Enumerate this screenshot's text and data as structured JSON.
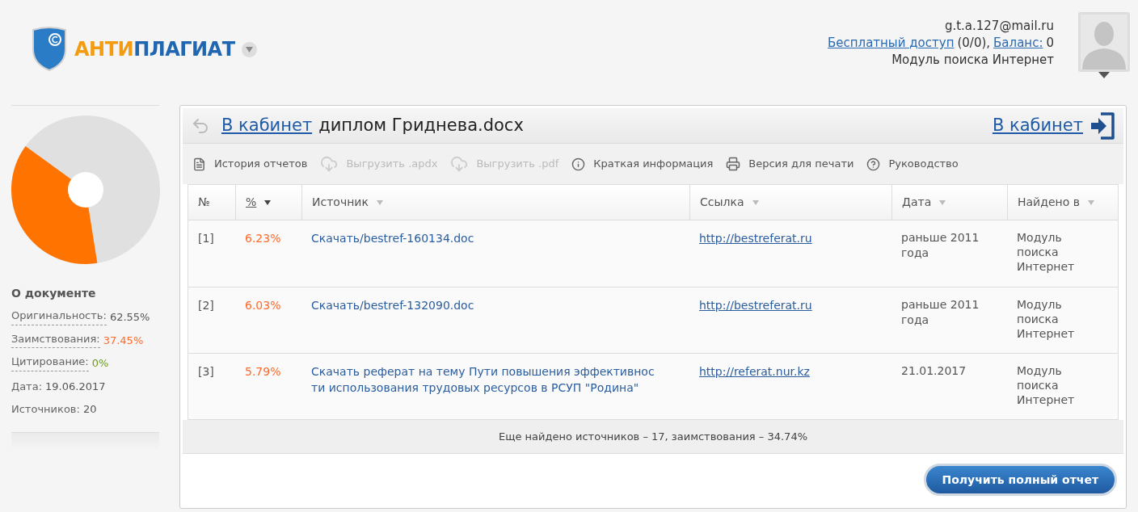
{
  "header": {
    "logo": {
      "part_1": "АНТИ",
      "part_2": "ПЛАГИАТ"
    },
    "user": {
      "email": "g.t.a.127@mail.ru",
      "free_access_link": "Бесплатный доступ",
      "free_access_count": "(0/0),",
      "balance_link": "Баланс:",
      "balance": "0",
      "module": "Модуль поиска Интернет"
    }
  },
  "sidebar": {
    "title": "О документе",
    "stats": [
      {
        "label": "Оригинальность:",
        "value": "62.55%",
        "kind": "original"
      },
      {
        "label": "Заимствования:",
        "value": "37.45%",
        "kind": "borrowed"
      },
      {
        "label": "Цитирование:",
        "value": "0%",
        "kind": "cited"
      },
      {
        "label": "Дата:",
        "value": "19.06.2017",
        "kind": "plain"
      },
      {
        "label": "Источников:",
        "value": "20",
        "kind": "plain"
      }
    ]
  },
  "report": {
    "back_link": "В кабинет",
    "document": "диплом Гриднева.docx",
    "cabinet_link": "В кабинет",
    "toolbar": [
      {
        "label": "История отчетов",
        "kind": "document",
        "disabled": false
      },
      {
        "label": "Выгрузить .apdx",
        "kind": "cloud",
        "disabled": true
      },
      {
        "label": "Выгрузить .pdf",
        "kind": "cloud",
        "disabled": true
      },
      {
        "label": "Краткая информация",
        "kind": "info",
        "disabled": false
      },
      {
        "label": "Версия для печати",
        "kind": "printer",
        "disabled": false
      },
      {
        "label": "Руководство",
        "kind": "help",
        "disabled": false
      }
    ],
    "table": {
      "columns": [
        {
          "label": "№",
          "sortable": false,
          "selected": false
        },
        {
          "label": "%",
          "sortable": true,
          "selected": true
        },
        {
          "label": "Источник",
          "sortable": true,
          "selected": false
        },
        {
          "label": "Ссылка",
          "sortable": true,
          "selected": false
        },
        {
          "label": "Дата",
          "sortable": true,
          "selected": false
        },
        {
          "label": "Найдено в",
          "sortable": true,
          "selected": false
        }
      ],
      "rows": [
        {
          "number": "[1]",
          "percent": "6.23%",
          "source": "Скачать/bestref-160134.doc",
          "link": "http://bestreferat.ru",
          "date": "раньше 2011 года",
          "found_in": "Модуль поиска Интернет"
        },
        {
          "number": "[2]",
          "percent": "6.03%",
          "source": "Скачать/bestref-132090.doc",
          "link": "http://bestreferat.ru",
          "date": "раньше 2011 года",
          "found_in": "Модуль поиска Интернет"
        },
        {
          "number": "[3]",
          "percent": "5.79%",
          "source": "Скачать реферат на тему Пути повышения эффективности использования трудовых ресурсов в РСУП \"Родина\"",
          "link": "http://referat.nur.kz",
          "date": "21.01.2017",
          "found_in": "Модуль поиска Интернет"
        }
      ]
    },
    "summary": "Еще найдено источников – 17, заимствования – 34.74%",
    "full_report_button": "Получить полный отчет"
  }
}
